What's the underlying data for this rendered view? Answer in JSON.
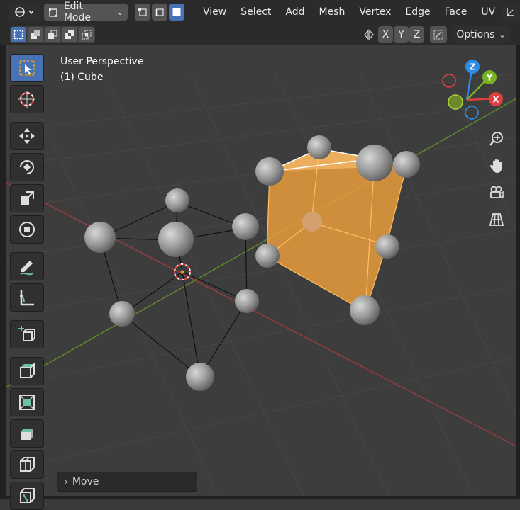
{
  "header": {
    "mode": "Edit Mode",
    "menus": [
      "View",
      "Select",
      "Add",
      "Mesh",
      "Vertex",
      "Edge",
      "Face",
      "UV"
    ]
  },
  "subheader": {
    "axes": [
      "X",
      "Y",
      "Z"
    ],
    "options_label": "Options"
  },
  "viewport": {
    "view_name": "User Perspective",
    "object_label": "(1) Cube"
  },
  "gizmo": {
    "x_label": "X",
    "y_label": "Y",
    "z_label": "Z",
    "colors": {
      "x": "#e04040",
      "y": "#7ab226",
      "z": "#2d8ce6"
    }
  },
  "last_operator": {
    "label": "Move"
  },
  "tools": [
    "select-box-tool",
    "cursor-tool",
    "move-tool",
    "rotate-tool",
    "scale-tool",
    "transform-tool",
    "annotate-tool",
    "measure-tool",
    "add-cube-tool",
    "extrude-tool",
    "inset-tool",
    "bevel-tool",
    "loop-cut-tool",
    "knife-tool"
  ],
  "colors": {
    "accent": "#4772b3",
    "selection": "#f0a030"
  }
}
